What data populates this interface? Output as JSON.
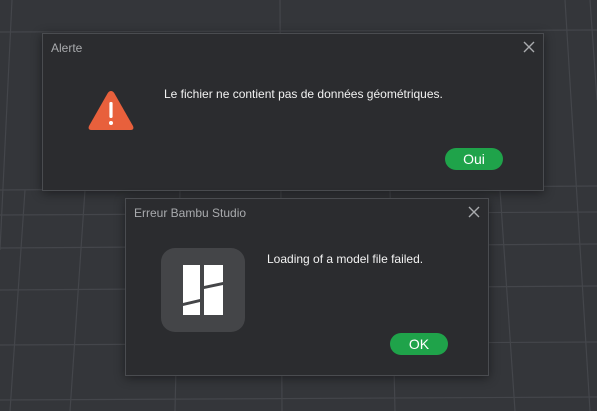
{
  "background": {
    "color": "#34363a",
    "grid_color": "#44464b"
  },
  "alert_dialog": {
    "title": "Alerte",
    "message": "Le fichier ne contient pas de données géométriques.",
    "icon": "warning-icon",
    "button_label": "Oui",
    "button_color": "#1fa34a",
    "icon_color": "#e8603c"
  },
  "error_dialog": {
    "title": "Erreur Bambu Studio",
    "message": "Loading of a model file failed.",
    "icon": "bambu-studio-logo",
    "button_label": "OK",
    "button_color": "#1fa34a"
  }
}
